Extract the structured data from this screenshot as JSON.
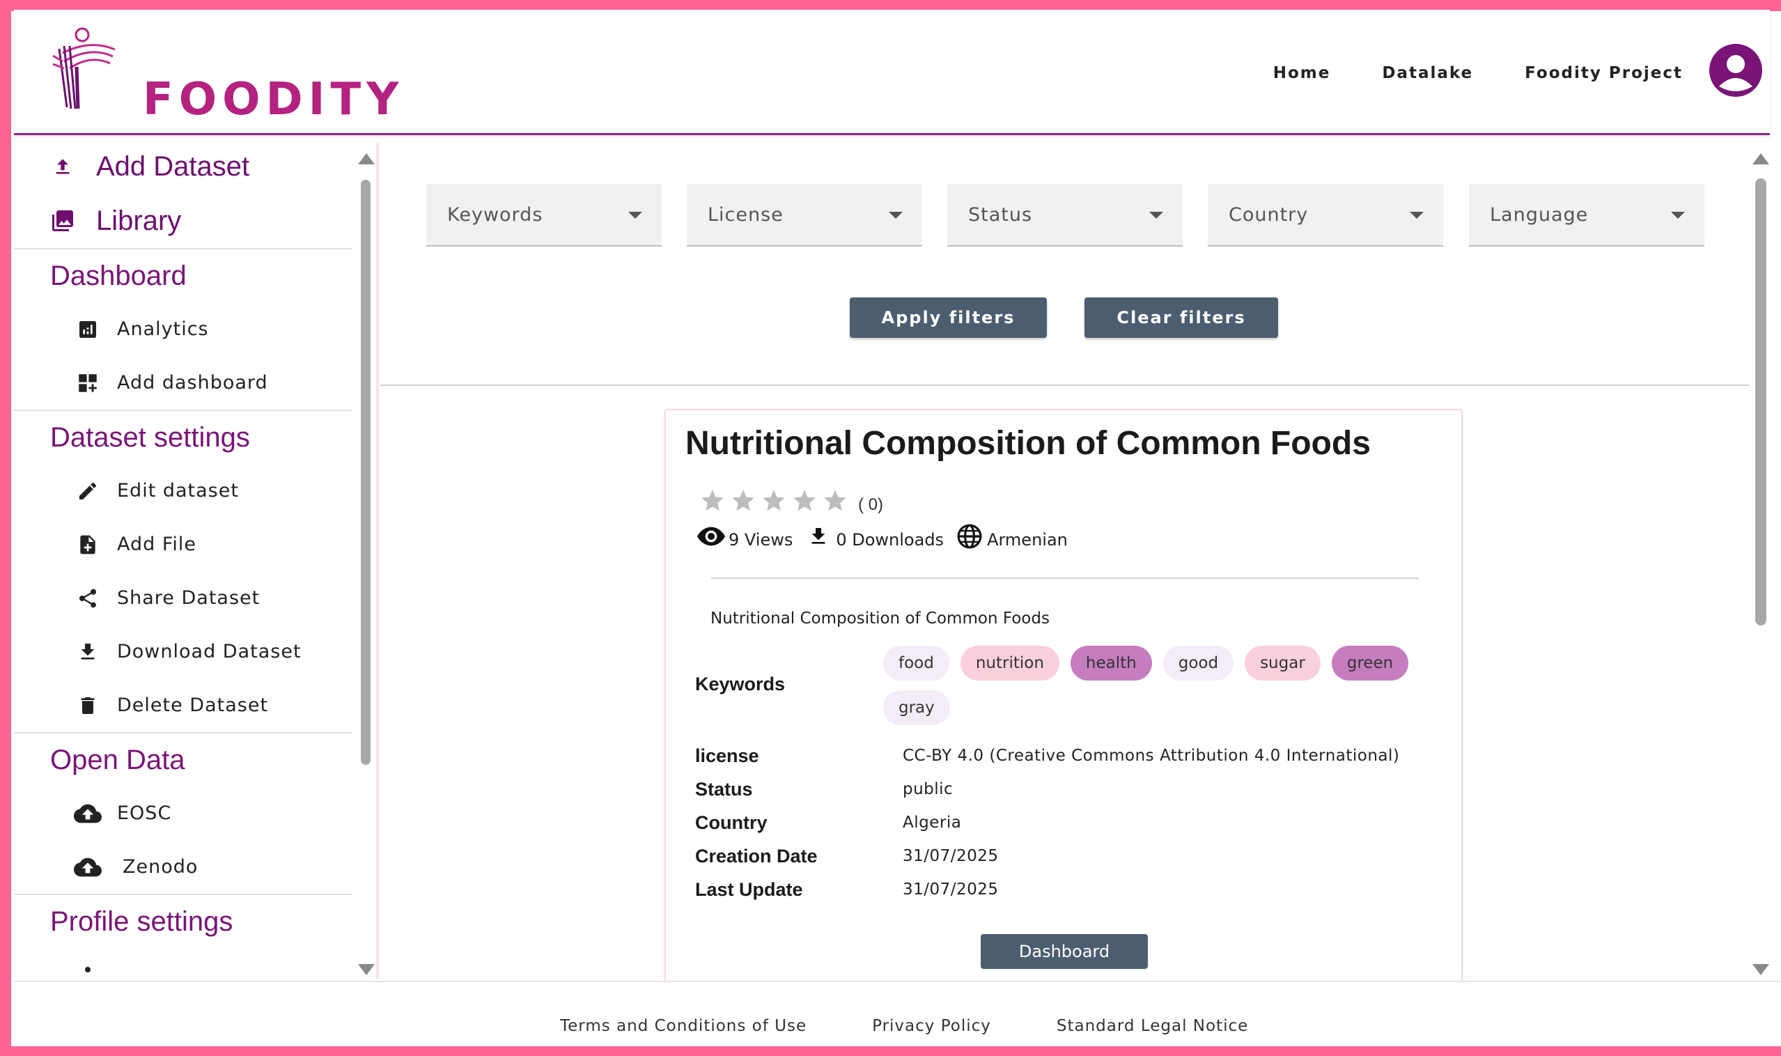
{
  "brand": {
    "name": "FOODITY",
    "color": "#b4237f"
  },
  "nav": {
    "items": [
      "Home",
      "Datalake",
      "Foodity Project"
    ]
  },
  "sidebar": {
    "primary": [
      {
        "label": "Add Dataset",
        "icon": "upload-icon"
      },
      {
        "label": "Library",
        "icon": "photo-library-icon"
      }
    ],
    "sections": [
      {
        "title": "Dashboard",
        "items": [
          {
            "label": "Analytics",
            "icon": "analytics-icon"
          },
          {
            "label": "Add dashboard",
            "icon": "add-dashboard-icon"
          }
        ]
      },
      {
        "title": "Dataset settings",
        "items": [
          {
            "label": "Edit dataset",
            "icon": "pencil-icon"
          },
          {
            "label": "Add File",
            "icon": "add-file-icon"
          },
          {
            "label": "Share Dataset",
            "icon": "share-icon"
          },
          {
            "label": "Download Dataset",
            "icon": "download-icon"
          },
          {
            "label": "Delete Dataset",
            "icon": "trash-icon"
          }
        ]
      },
      {
        "title": "Open Data",
        "items": [
          {
            "label": "EOSC",
            "icon": "cloud-upload-icon"
          },
          {
            "label": "Zenodo",
            "icon": "cloud-upload-icon"
          }
        ]
      },
      {
        "title": "Profile settings",
        "items": []
      }
    ]
  },
  "filters": {
    "fields": [
      "Keywords",
      "License",
      "Status",
      "Country",
      "Language"
    ],
    "apply_label": "Apply filters",
    "clear_label": "Clear filters"
  },
  "dataset": {
    "title": "Nutritional Composition of Common Foods",
    "rating": 0,
    "rating_count": "( 0)",
    "views": "9 Views",
    "downloads": "0 Downloads",
    "language": "Armenian",
    "description": "Nutritional Composition of Common Foods",
    "keywords_label": "Keywords",
    "keywords": [
      {
        "text": "food",
        "bg": "#f4ecf6"
      },
      {
        "text": "nutrition",
        "bg": "#fbd0dc"
      },
      {
        "text": "health",
        "bg": "#c57dc0"
      },
      {
        "text": "good",
        "bg": "#f4ecf6"
      },
      {
        "text": "sugar",
        "bg": "#fbd0dc"
      },
      {
        "text": "green",
        "bg": "#c57dc0"
      },
      {
        "text": "gray",
        "bg": "#f4ecf6"
      }
    ],
    "meta": [
      {
        "key": "license",
        "value": "CC-BY 4.0 (Creative Commons Attribution 4.0 International)"
      },
      {
        "key": "Status",
        "value": "public"
      },
      {
        "key": "Country",
        "value": "Algeria"
      },
      {
        "key": "Creation Date",
        "value": "31/07/2025"
      },
      {
        "key": "Last Update",
        "value": "31/07/2025"
      }
    ],
    "dashboard_label": "Dashboard"
  },
  "footer": {
    "links": [
      "Terms and Conditions of Use",
      "Privacy Policy",
      "Standard Legal Notice"
    ]
  }
}
